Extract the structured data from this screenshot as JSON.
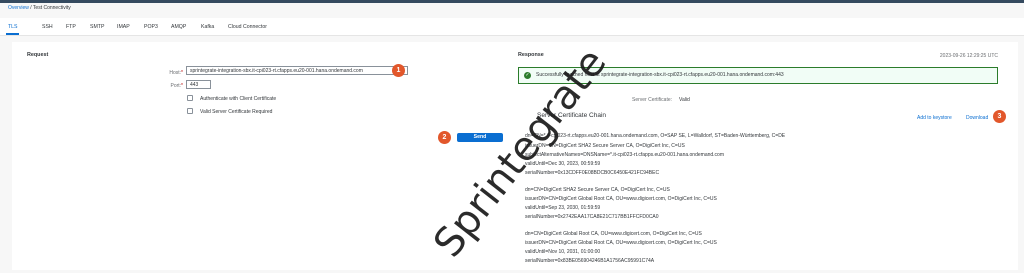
{
  "breadcrumb": {
    "link": "Overview",
    "separator": " / ",
    "current": "Test Connectivity"
  },
  "tabs": [
    "TLS",
    "SSH",
    "FTP",
    "SMTP",
    "IMAP",
    "POP3",
    "AMQP",
    "Kafka",
    "Cloud Connector"
  ],
  "request": {
    "title": "Request",
    "host_label": "Host:",
    "host_value": "sprintegrate-integration-sbx.it-cpi023-rt.cfapps.eu20-001.hana.ondemand.com",
    "port_label": "Port:",
    "port_value": "443",
    "required_mark": "*",
    "auth_label": "Authenticate with Client Certificate",
    "valid_label": "Valid Server Certificate Required",
    "send_label": "Send"
  },
  "response": {
    "title": "Response",
    "timestamp": "2023-09-26 12:29:25 UTC",
    "success_text": "Successfully reached host at sprintegrate-integration-sbx.it-cpi023-rt.cfapps.eu20-001.hana.ondemand.com:443",
    "server_cert_label": "Server Certificate:",
    "server_cert_value": "Valid",
    "chain_title": "Server Certificate Chain",
    "add_keystore": "Add to keystore",
    "download": "Download",
    "cert_lines": [
      "dn=CN=*.it-cpi023-rt.cfapps.eu20-001.hana.ondemand.com, O=SAP SE, L=Walldorf, ST=Baden-Württemberg, C=DE",
      "issuerDN=CN=DigiCert SHA2 Secure Server CA, O=DigiCert Inc, C=US",
      "subjectAlternativeNames=DNSName=*.it-cpi023-rt.cfapps.eu20-001.hana.ondemand.com",
      "validUntil=Dec 30, 2023, 00:59:59",
      "serialNumber=0x13CDFF0E08BDCB0C6450E421FC94BEC",
      "dn=CN=DigiCert SHA2 Secure Server CA, O=DigiCert Inc, C=US",
      "issuerDN=CN=DigiCert Global Root CA, OU=www.digicert.com, O=DigiCert Inc, C=US",
      "validUntil=Sep 23, 2030, 01:59:59",
      "serialNumber=0x2742EAA17CA8E21C717BB1FFCFD0CA0",
      "dn=CN=DigiCert Global Root CA, OU=www.digicert.com, O=DigiCert Inc, C=US",
      "issuerDN=CN=DigiCert Global Root CA, OU=www.digicert.com, O=DigiCert Inc, C=US",
      "validUntil=Nov 10, 2031, 01:00:00",
      "serialNumber=0x83BE056904246B1A1756AC95991C74A"
    ]
  },
  "badges": [
    "1",
    "2",
    "3"
  ],
  "watermark": "Sprintegrate",
  "colors": {
    "accent": "#0a6ed1",
    "badge": "#e2572b",
    "success": "#2b7c2b"
  }
}
